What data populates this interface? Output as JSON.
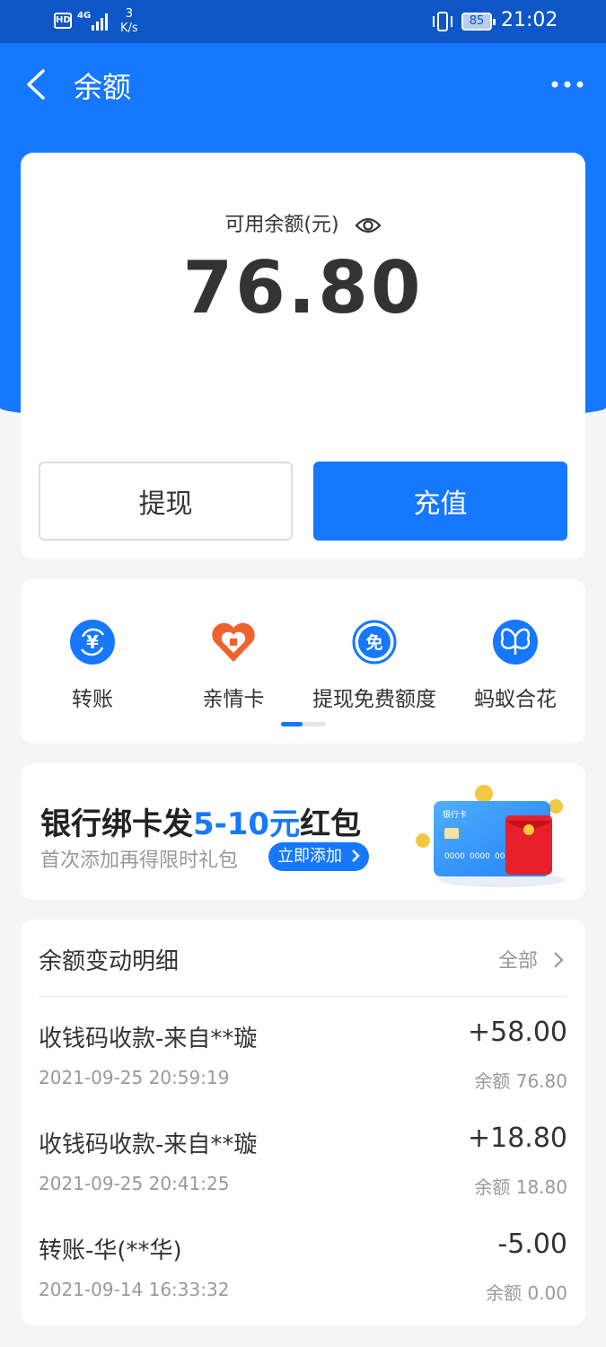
{
  "status_bar": {
    "hd": "HD",
    "network": "4G",
    "speed_value": "3",
    "speed_unit": "K/s",
    "battery": "85",
    "time": "21:02"
  },
  "nav": {
    "title": "余额"
  },
  "balance": {
    "label": "可用余额(元)",
    "amount": "76.80",
    "withdraw_label": "提现",
    "recharge_label": "充值"
  },
  "services": {
    "items": [
      {
        "label": "转账",
        "icon": "transfer-yuan-icon"
      },
      {
        "label": "亲情卡",
        "icon": "family-card-heart-icon"
      },
      {
        "label": "提现免费额度",
        "icon": "free-withdraw-icon"
      },
      {
        "label": "蚂蚁合花",
        "icon": "ant-flower-icon"
      }
    ],
    "page_indicator": {
      "pages": 2,
      "current": 1
    }
  },
  "promo": {
    "title_prefix": "银行绑卡发",
    "title_highlight": "5-10元",
    "title_suffix": "红包",
    "subtitle": "首次添加再得限时礼包",
    "button_label": "立即添加",
    "card_text": "银行卡",
    "card_number_1": "0000",
    "card_number_2": "0000",
    "card_number_3": "00"
  },
  "details": {
    "heading": "余额变动明细",
    "all_label": "全部",
    "items": [
      {
        "desc": "收钱码收款-来自**璇",
        "time": "2021-09-25 20:59:19",
        "amount": "+58.00",
        "balance": "余额 76.80"
      },
      {
        "desc": "收钱码收款-来自**璇",
        "time": "2021-09-25 20:41:25",
        "amount": "+18.80",
        "balance": "余额 18.80"
      },
      {
        "desc": "转账-华(**华)",
        "time": "2021-09-14 16:33:32",
        "amount": "-5.00",
        "balance": "余额 0.00"
      }
    ]
  },
  "colors": {
    "primary": "#1677ff",
    "status_bar": "#0f57c6",
    "family_card": "#f0622d"
  }
}
